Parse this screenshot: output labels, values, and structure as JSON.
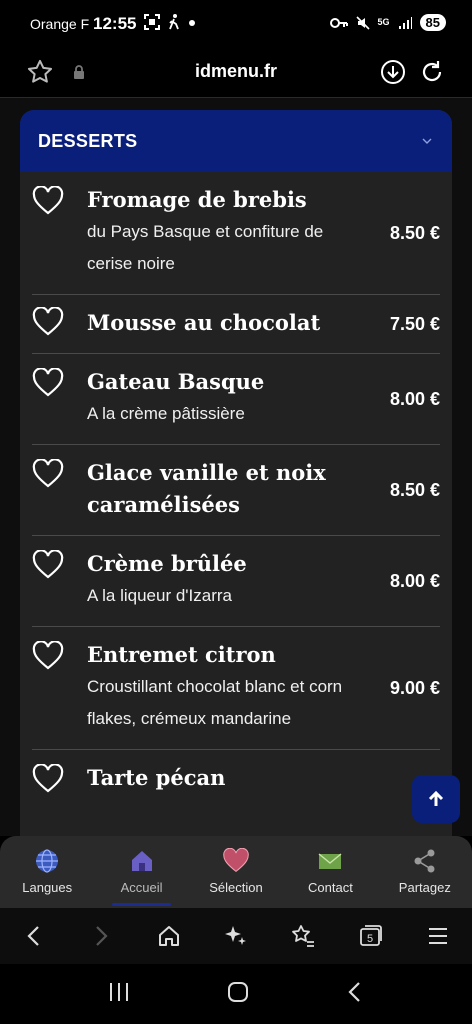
{
  "status_bar": {
    "carrier": "Orange F",
    "time": "12:55",
    "network": "5G",
    "battery": "85"
  },
  "browser": {
    "url": "idmenu.fr",
    "tabs_count": "5"
  },
  "section": {
    "title": "DESSERTS",
    "items": [
      {
        "name": "Fromage de brebis",
        "desc": "du Pays Basque et confiture de cerise noire",
        "price": "8.50 €"
      },
      {
        "name": "Mousse au chocolat",
        "desc": "",
        "price": "7.50 €"
      },
      {
        "name": "Gateau Basque",
        "desc": "A la crème pâtissière",
        "price": "8.00 €"
      },
      {
        "name": "Glace vanille et noix caramélisées",
        "desc": "",
        "price": "8.50 €"
      },
      {
        "name": "Crème brûlée",
        "desc": "A la liqueur d'Izarra",
        "price": "8.00 €"
      },
      {
        "name": "Entremet citron",
        "desc": "Croustillant chocolat blanc et corn flakes, crémeux mandarine",
        "price": "9.00 €"
      },
      {
        "name": "Tarte pécan",
        "desc": "",
        "price": ""
      }
    ]
  },
  "bottom_nav": {
    "items": [
      {
        "label": "Langues",
        "icon": "globe-icon",
        "color": "#3b5bbf"
      },
      {
        "label": "Accueil",
        "icon": "house-icon",
        "color": "#6a5fc4"
      },
      {
        "label": "Sélection",
        "icon": "heart-icon",
        "color": "#c0506a"
      },
      {
        "label": "Contact",
        "icon": "envelope-icon",
        "color": "#6fa34a"
      },
      {
        "label": "Partagez",
        "icon": "share-icon",
        "color": "#9a9a9a"
      }
    ],
    "active": "Accueil"
  },
  "colors": {
    "header_bg": "#0a1f7a",
    "panel_bg": "#222222",
    "page_bg": "#0e0e0e",
    "accent": "#1c2c90"
  }
}
